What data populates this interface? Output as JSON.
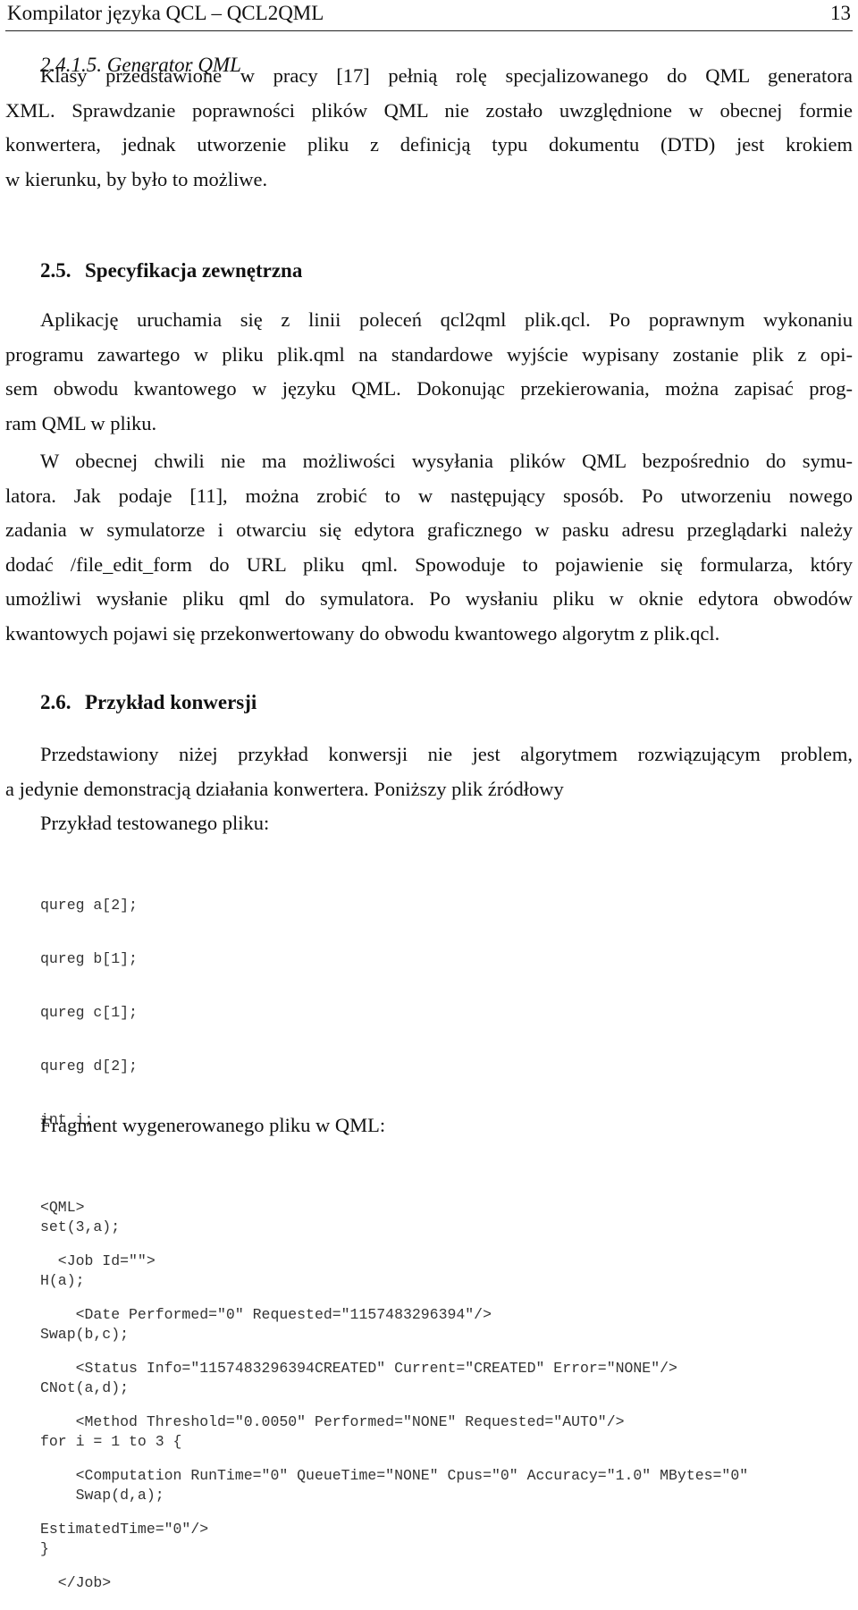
{
  "header": {
    "title": "Kompilator języka QCL – QCL2QML",
    "page_number": "13"
  },
  "subsection_2_4_1_5": {
    "heading": "2.4.1.5.  Generator QML",
    "lines": [
      "Klasy przedstawione w pracy [17] pełnią rolę specjalizowanego do QML generatora",
      "XML. Sprawdzanie poprawności plików QML nie zostało uwzględnione w obecnej formie",
      "konwertera, jednak utworzenie pliku z definicją typu dokumentu (DTD) jest krokiem",
      "w kierunku, by było to możliwe."
    ]
  },
  "section_2_5": {
    "number": "2.5.",
    "title": "Specyfikacja zewnętrzna",
    "paragraph1": [
      "Aplikację uruchamia się z linii poleceń qcl2qml plik.qcl. Po poprawnym wykonaniu",
      "programu zawartego w pliku plik.qml na standardowe wyjście wypisany zostanie plik z opi-",
      "sem obwodu kwantowego w języku QML. Dokonując przekierowania, można zapisać prog-",
      "ram QML w pliku."
    ],
    "paragraph2": [
      "W obecnej chwili nie ma możliwości wysyłania plików QML bezpośrednio do symu-",
      "latora. Jak podaje [11], można zrobić to w następujący sposób. Po utworzeniu nowego",
      "zadania w symulatorze i otwarciu się edytora graficznego w pasku adresu przeglądarki należy",
      "dodać /file_edit_form do URL pliku qml. Spowoduje to pojawienie się formularza, który",
      "umożliwi wysłanie pliku qml do symulatora. Po wysłaniu pliku w oknie edytora obwodów",
      "kwantowych pojawi się przekonwertowany do obwodu kwantowego algorytm z plik.qcl."
    ]
  },
  "section_2_6": {
    "number": "2.6.",
    "title": "Przykład konwersji",
    "paragraph": [
      "Przedstawiony niżej przykład konwersji nie jest algorytmem rozwiązującym problem,",
      "a jedynie demonstracją działania konwertera. Poniższy plik źródłowy"
    ],
    "example_label": "Przykład testowanego pliku:",
    "source_code": [
      "qureg a[2];",
      "qureg b[1];",
      "qureg c[1];",
      "qureg d[2];",
      "int i;",
      "",
      "set(3,a);",
      "H(a);",
      "Swap(b,c);",
      "CNot(a,d);",
      "for i = 1 to 3 {",
      "    Swap(d,a);",
      "}"
    ],
    "fragment_label": "Fragment wygenerowanego pliku w QML:",
    "qml_code": [
      "<QML>",
      "  <Job Id=\"\">",
      "    <Date Performed=\"0\" Requested=\"1157483296394\"/>",
      "    <Status Info=\"1157483296394CREATED\" Current=\"CREATED\" Error=\"NONE\"/>",
      "    <Method Threshold=\"0.0050\" Performed=\"NONE\" Requested=\"AUTO\"/>",
      "    <Computation RunTime=\"0\" QueueTime=\"NONE\" Cpus=\"0\" Accuracy=\"1.0\" MBytes=\"0\"",
      "EstimatedTime=\"0\"/>",
      "  </Job>"
    ]
  }
}
